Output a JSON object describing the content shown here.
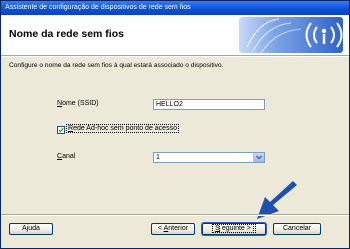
{
  "window": {
    "title": "Assistente de configuração de dispositivos de rede sem fios"
  },
  "banner": {
    "title": "Nome da rede sem fios",
    "logo_icon": "wireless-signal-icon"
  },
  "description": "Configure o nome da rede sem fios à qual estará associado o dispositivo.",
  "form": {
    "ssid_label_prefix": "N",
    "ssid_label_rest": "ome (SSID)",
    "ssid_value": "HELLO2",
    "adhoc_checked": true,
    "adhoc_label_prefix": "R",
    "adhoc_label_rest": "ede Ad-hoc sem ponto de acesso",
    "channel_label_prefix": "C",
    "channel_label_rest": "anal",
    "channel_value": "1"
  },
  "buttons": {
    "help": "Ajuda",
    "back_prefix": "< ",
    "back_access": "A",
    "back_rest": "nterior",
    "next_access": "S",
    "next_rest": "eguinte >",
    "cancel": "Cancelar"
  },
  "colors": {
    "titlebar": "#0a4fd6",
    "pointer_arrow": "#1f4fb0"
  }
}
